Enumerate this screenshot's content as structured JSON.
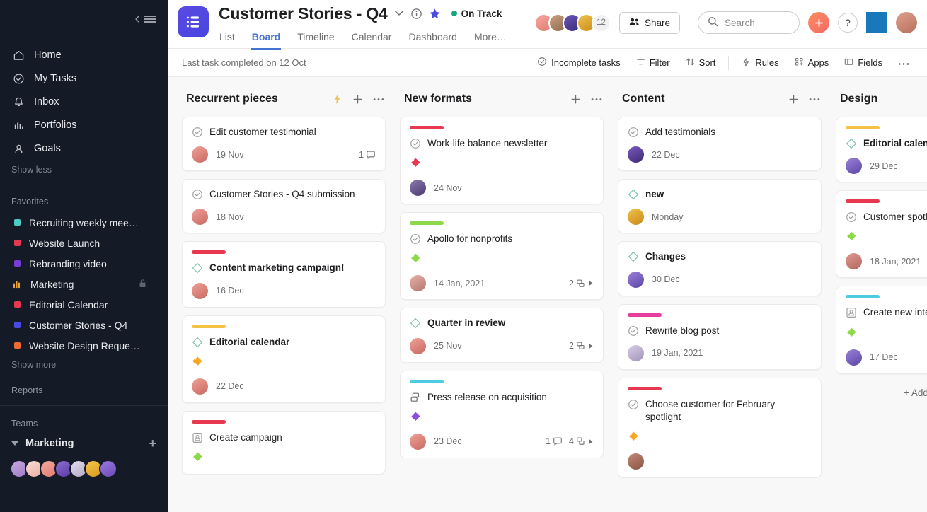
{
  "sidebar": {
    "collapse_icon": "collapse-sidebar-icon",
    "nav": [
      {
        "label": "Home",
        "icon": "home-icon"
      },
      {
        "label": "My Tasks",
        "icon": "check-circle-icon"
      },
      {
        "label": "Inbox",
        "icon": "bell-icon"
      },
      {
        "label": "Portfolios",
        "icon": "bar-chart-icon"
      },
      {
        "label": "Goals",
        "icon": "goal-person-icon"
      }
    ],
    "show_less": "Show less",
    "favorites_title": "Favorites",
    "favorites": [
      {
        "label": "Recruiting weekly mee…",
        "color": "#4ecbc4",
        "type": "dot"
      },
      {
        "label": "Website Launch",
        "color": "#e8384f",
        "type": "dot"
      },
      {
        "label": "Rebranding video",
        "color": "#7a3bdb",
        "type": "dot"
      },
      {
        "label": "Marketing",
        "color": "#e8a33d",
        "type": "chart",
        "locked": true
      },
      {
        "label": "Editorial Calendar",
        "color": "#e8384f",
        "type": "dot"
      },
      {
        "label": "Customer Stories - Q4",
        "color": "#4a4ae3",
        "type": "dot"
      },
      {
        "label": "Website Design Reque…",
        "color": "#f06a33",
        "type": "dot"
      }
    ],
    "show_more": "Show more",
    "reports_title": "Reports",
    "teams_title": "Teams",
    "team_name": "Marketing",
    "team_avatar_colors": [
      "#b48ad6",
      "#f4c8c0",
      "#f59b9b",
      "#7b5bd6",
      "#d9d2e9",
      "#e8b23d",
      "#8b6bd6"
    ]
  },
  "header": {
    "project_icon": "project-list-icon",
    "title": "Customer Stories - Q4",
    "dropdown_icon": "chevron-down-icon",
    "info_icon": "info-icon",
    "star_icon": "star-icon",
    "star_color": "#4a4ae3",
    "status_label": "On Track",
    "status_color": "#14a67d",
    "tabs": [
      {
        "label": "List",
        "active": false
      },
      {
        "label": "Board",
        "active": true
      },
      {
        "label": "Timeline",
        "active": false
      },
      {
        "label": "Calendar",
        "active": false
      },
      {
        "label": "Dashboard",
        "active": false
      },
      {
        "label": "More…",
        "active": false
      }
    ],
    "member_avatar_colors": [
      "#f08b8b",
      "#b98f6e",
      "#4a3b8c",
      "#e8b23d"
    ],
    "member_count": "12",
    "share_label": "Share",
    "share_icon": "people-icon",
    "search_placeholder": "Search",
    "search_value": "",
    "search_icon": "search-icon",
    "create_icon": "plus-icon",
    "help_icon": "question-mark-icon",
    "blue_square_color": "#1878b9",
    "me_avatar_color": "#c87a6a"
  },
  "toolbar": {
    "last_task": "Last task completed on 12 Oct",
    "buttons": [
      {
        "label": "Incomplete tasks",
        "icon": "check-circle-icon"
      },
      {
        "label": "Filter",
        "icon": "filter-icon"
      },
      {
        "label": "Sort",
        "icon": "sort-icon"
      },
      {
        "label": "Rules",
        "icon": "lightning-icon"
      },
      {
        "label": "Apps",
        "icon": "apps-grid-icon"
      },
      {
        "label": "Fields",
        "icon": "fields-icon"
      }
    ],
    "more_icon": "ellipsis-icon"
  },
  "board": {
    "add_task_label": "+ Add task",
    "columns": [
      {
        "title": "Recurrent pieces",
        "has_lightning": true,
        "cards": [
          {
            "title": "Edit customer testimonial",
            "icon": "check-circle-icon",
            "bold": false,
            "cover": null,
            "tag": null,
            "avatar_color": "#e88a8a",
            "date": "19 Nov",
            "comments": "1",
            "subtasks": null
          },
          {
            "title": "Customer Stories - Q4 submission",
            "icon": "check-circle-icon",
            "bold": false,
            "cover": null,
            "tag": null,
            "avatar_color": "#e88a8a",
            "date": "18 Nov",
            "comments": null,
            "subtasks": null
          },
          {
            "title": "Content marketing campaign!",
            "icon": "diamond-icon",
            "bold": true,
            "cover": "#e8384f",
            "tag": null,
            "avatar_color": "#e88a8a",
            "date": "16 Dec",
            "comments": null,
            "subtasks": null
          },
          {
            "title": "Editorial calendar",
            "icon": "diamond-icon",
            "bold": true,
            "cover": "#f5c343",
            "tag": "#f5a623",
            "avatar_color": "#e88a8a",
            "date": "22 Dec",
            "comments": null,
            "subtasks": null
          },
          {
            "title": "Create campaign",
            "icon": "approval-icon",
            "bold": false,
            "cover": "#e8384f",
            "tag": "#7ed321",
            "avatar_color": "#e88a8a",
            "date": "",
            "comments": null,
            "subtasks": null
          }
        ]
      },
      {
        "title": "New formats",
        "has_lightning": false,
        "cards": [
          {
            "title": "Work-life balance newsletter",
            "icon": "check-circle-icon",
            "bold": false,
            "cover": "#e8384f",
            "tag": "#e8384f",
            "avatar_color": "#6b5b8c",
            "date": "24 Nov",
            "comments": null,
            "subtasks": null
          },
          {
            "title": "Apollo for nonprofits",
            "icon": "check-circle-icon",
            "bold": false,
            "cover": "#8ed94a",
            "tag": "#8ed94a",
            "avatar_color": "#d9a0a0",
            "date": "14 Jan, 2021",
            "comments": null,
            "subtasks": "2"
          },
          {
            "title": "Quarter in review",
            "icon": "diamond-icon",
            "bold": true,
            "cover": null,
            "tag": null,
            "avatar_color": "#e88a8a",
            "date": "25 Nov",
            "comments": null,
            "subtasks": "2"
          },
          {
            "title": "Press release on acquisition",
            "icon": "approval-icon",
            "bold": false,
            "cover": "#4ecbe0",
            "tag": "#8b4ae0",
            "avatar_color": "#e88a8a",
            "date": "23 Dec",
            "comments": "1",
            "subtasks": "4"
          }
        ]
      },
      {
        "title": "Content",
        "has_lightning": false,
        "cards": [
          {
            "title": "Add testimonials",
            "icon": "check-circle-icon",
            "bold": false,
            "cover": null,
            "tag": null,
            "avatar_color": "#6b4ab5",
            "date": "22 Dec",
            "comments": null,
            "subtasks": null
          },
          {
            "title": "new",
            "icon": "diamond-icon",
            "bold": true,
            "cover": null,
            "tag": null,
            "avatar_color": "#e8a33d",
            "date": "Monday",
            "comments": null,
            "subtasks": null
          },
          {
            "title": "Changes",
            "icon": "diamond-icon",
            "bold": true,
            "cover": null,
            "tag": null,
            "avatar_color": "#7b5bd6",
            "date": "30 Dec",
            "comments": null,
            "subtasks": null
          },
          {
            "title": "Rewrite blog post",
            "icon": "check-circle-icon",
            "bold": false,
            "cover": "#e83f9e",
            "tag": null,
            "avatar_color": "#c9bcd9",
            "date": "19 Jan, 2021",
            "comments": null,
            "subtasks": null
          },
          {
            "title": "Choose customer for February spotlight",
            "icon": "check-circle-icon",
            "bold": false,
            "cover": "#e8384f",
            "tag": "#f5a623",
            "avatar_color": "#b5705a",
            "date": "",
            "comments": null,
            "subtasks": null
          }
        ]
      },
      {
        "title": "Design",
        "has_lightning": false,
        "cards": [
          {
            "title": "Editorial calendar",
            "icon": "diamond-icon",
            "bold": true,
            "cover": "#f5c343",
            "tag": null,
            "avatar_color": "#7b5bd6",
            "date": "29 Dec",
            "comments": null,
            "subtasks": null
          },
          {
            "title": "Customer spotlight",
            "icon": "check-circle-icon",
            "bold": false,
            "cover": "#e8384f",
            "tag": "#8ed94a",
            "avatar_color": "#d98a8a",
            "date": "18 Jan, 2021",
            "comments": null,
            "subtasks": null
          },
          {
            "title": "Create new internal design",
            "icon": "approval-icon",
            "bold": false,
            "cover": "#4ecbe0",
            "tag": "#8ed94a",
            "avatar_color": "#7b5bd6",
            "date": "17 Dec",
            "comments": null,
            "subtasks": null
          }
        ]
      }
    ]
  }
}
